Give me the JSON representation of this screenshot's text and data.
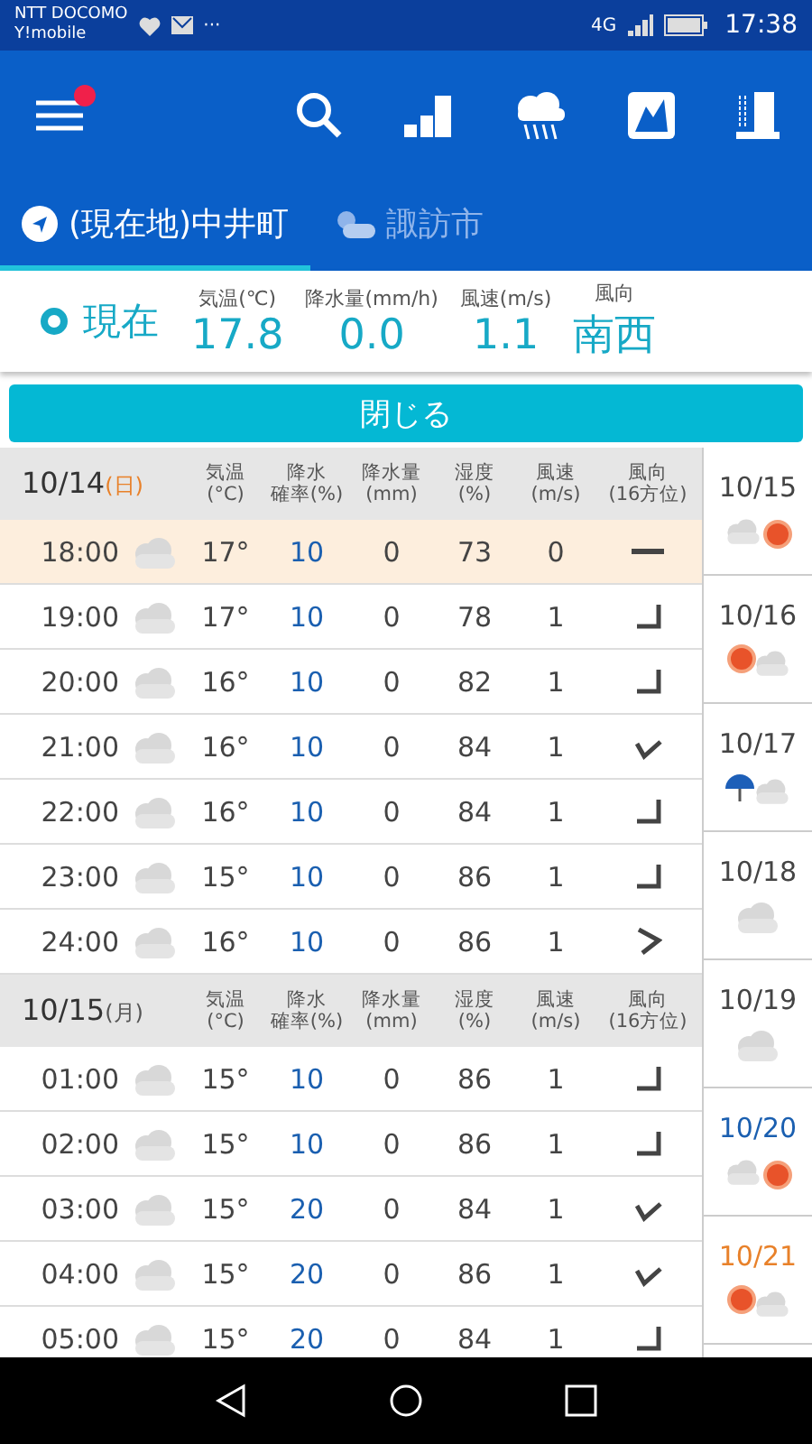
{
  "status_bar": {
    "carrier": "NTT DOCOMO",
    "carrier_2": "Y!mobile",
    "notification_more": "···",
    "network": "4G",
    "time": "17:38"
  },
  "app_bar": {
    "menu_badge": true
  },
  "tabs": [
    {
      "label": "(現在地)中井町",
      "selected": true,
      "kind": "location"
    },
    {
      "label": "諏訪市",
      "selected": false,
      "kind": "weather"
    }
  ],
  "current": {
    "label": "現在",
    "columns": [
      {
        "heading": "気温(℃)",
        "value": "17.8"
      },
      {
        "heading": "降水量(mm/h)",
        "value": "0.0"
      },
      {
        "heading": "風速(m/s)",
        "value": "1.1"
      },
      {
        "heading": "風向",
        "value": "南西"
      }
    ]
  },
  "close_button": "閉じる",
  "table": {
    "days": [
      {
        "date": "10/14",
        "weekday": "(日)",
        "color": "#e8812a",
        "columns": [
          [
            "気温",
            "(°C)"
          ],
          [
            "降水",
            "確率(%)"
          ],
          [
            "降水量",
            "(mm)"
          ],
          [
            "湿度",
            "(%)"
          ],
          [
            "風速",
            "(m/s)"
          ],
          [
            "風向",
            "(16方位)"
          ]
        ],
        "rows": [
          {
            "time": "18:00",
            "weather": {
              "kind": "cloudy"
            },
            "temp": "17°",
            "pop": "10",
            "rain": "0",
            "humidity": "73",
            "wind_speed": "0",
            "wind": {
              "kind": "calm"
            },
            "selected": true
          },
          {
            "time": "19:00",
            "weather": {
              "kind": "cloudy"
            },
            "temp": "17°",
            "pop": "10",
            "rain": "0",
            "humidity": "78",
            "wind_speed": "1",
            "wind": {
              "kind": "sw"
            },
            "selected": false
          },
          {
            "time": "20:00",
            "weather": {
              "kind": "cloudy"
            },
            "temp": "16°",
            "pop": "10",
            "rain": "0",
            "humidity": "82",
            "wind_speed": "1",
            "wind": {
              "kind": "sw"
            },
            "selected": false
          },
          {
            "time": "21:00",
            "weather": {
              "kind": "cloudy"
            },
            "temp": "16°",
            "pop": "10",
            "rain": "0",
            "humidity": "84",
            "wind_speed": "1",
            "wind": {
              "kind": "s"
            },
            "selected": false
          },
          {
            "time": "22:00",
            "weather": {
              "kind": "cloudy"
            },
            "temp": "16°",
            "pop": "10",
            "rain": "0",
            "humidity": "84",
            "wind_speed": "1",
            "wind": {
              "kind": "sw"
            },
            "selected": false
          },
          {
            "time": "23:00",
            "weather": {
              "kind": "cloudy"
            },
            "temp": "15°",
            "pop": "10",
            "rain": "0",
            "humidity": "86",
            "wind_speed": "1",
            "wind": {
              "kind": "sw"
            },
            "selected": false
          },
          {
            "time": "24:00",
            "weather": {
              "kind": "cloudy"
            },
            "temp": "16°",
            "pop": "10",
            "rain": "0",
            "humidity": "86",
            "wind_speed": "1",
            "wind": {
              "kind": "wsw"
            },
            "selected": false
          }
        ]
      },
      {
        "date": "10/15",
        "weekday": "(月)",
        "color": "#555555",
        "columns": [
          [
            "気温",
            "(°C)"
          ],
          [
            "降水",
            "確率(%)"
          ],
          [
            "降水量",
            "(mm)"
          ],
          [
            "湿度",
            "(%)"
          ],
          [
            "風速",
            "(m/s)"
          ],
          [
            "風向",
            "(16方位)"
          ]
        ],
        "rows": [
          {
            "time": "01:00",
            "weather": {
              "kind": "cloudy"
            },
            "temp": "15°",
            "pop": "10",
            "rain": "0",
            "humidity": "86",
            "wind_speed": "1",
            "wind": {
              "kind": "sw"
            },
            "selected": false
          },
          {
            "time": "02:00",
            "weather": {
              "kind": "cloudy"
            },
            "temp": "15°",
            "pop": "10",
            "rain": "0",
            "humidity": "86",
            "wind_speed": "1",
            "wind": {
              "kind": "sw"
            },
            "selected": false
          },
          {
            "time": "03:00",
            "weather": {
              "kind": "cloudy"
            },
            "temp": "15°",
            "pop": "20",
            "rain": "0",
            "humidity": "84",
            "wind_speed": "1",
            "wind": {
              "kind": "s"
            },
            "selected": false
          },
          {
            "time": "04:00",
            "weather": {
              "kind": "cloudy"
            },
            "temp": "15°",
            "pop": "20",
            "rain": "0",
            "humidity": "86",
            "wind_speed": "1",
            "wind": {
              "kind": "s"
            },
            "selected": false
          },
          {
            "time": "05:00",
            "weather": {
              "kind": "cloudy"
            },
            "temp": "15°",
            "pop": "20",
            "rain": "0",
            "humidity": "84",
            "wind_speed": "1",
            "wind": {
              "kind": "sw"
            },
            "selected": false
          }
        ]
      }
    ]
  },
  "week": [
    {
      "date": "10/15",
      "color": "#444444",
      "weather": {
        "kind": "cloudy_then_sunny"
      }
    },
    {
      "date": "10/16",
      "color": "#444444",
      "weather": {
        "kind": "sunny_then_cloudy"
      }
    },
    {
      "date": "10/17",
      "color": "#444444",
      "weather": {
        "kind": "rain_then_cloudy"
      }
    },
    {
      "date": "10/18",
      "color": "#444444",
      "weather": {
        "kind": "cloudy"
      }
    },
    {
      "date": "10/19",
      "color": "#444444",
      "weather": {
        "kind": "cloudy"
      }
    },
    {
      "date": "10/20",
      "color": "#1a5fb0",
      "weather": {
        "kind": "cloudy_then_sunny"
      }
    },
    {
      "date": "10/21",
      "color": "#e8812a",
      "weather": {
        "kind": "sunny_then_cloudy"
      }
    }
  ]
}
